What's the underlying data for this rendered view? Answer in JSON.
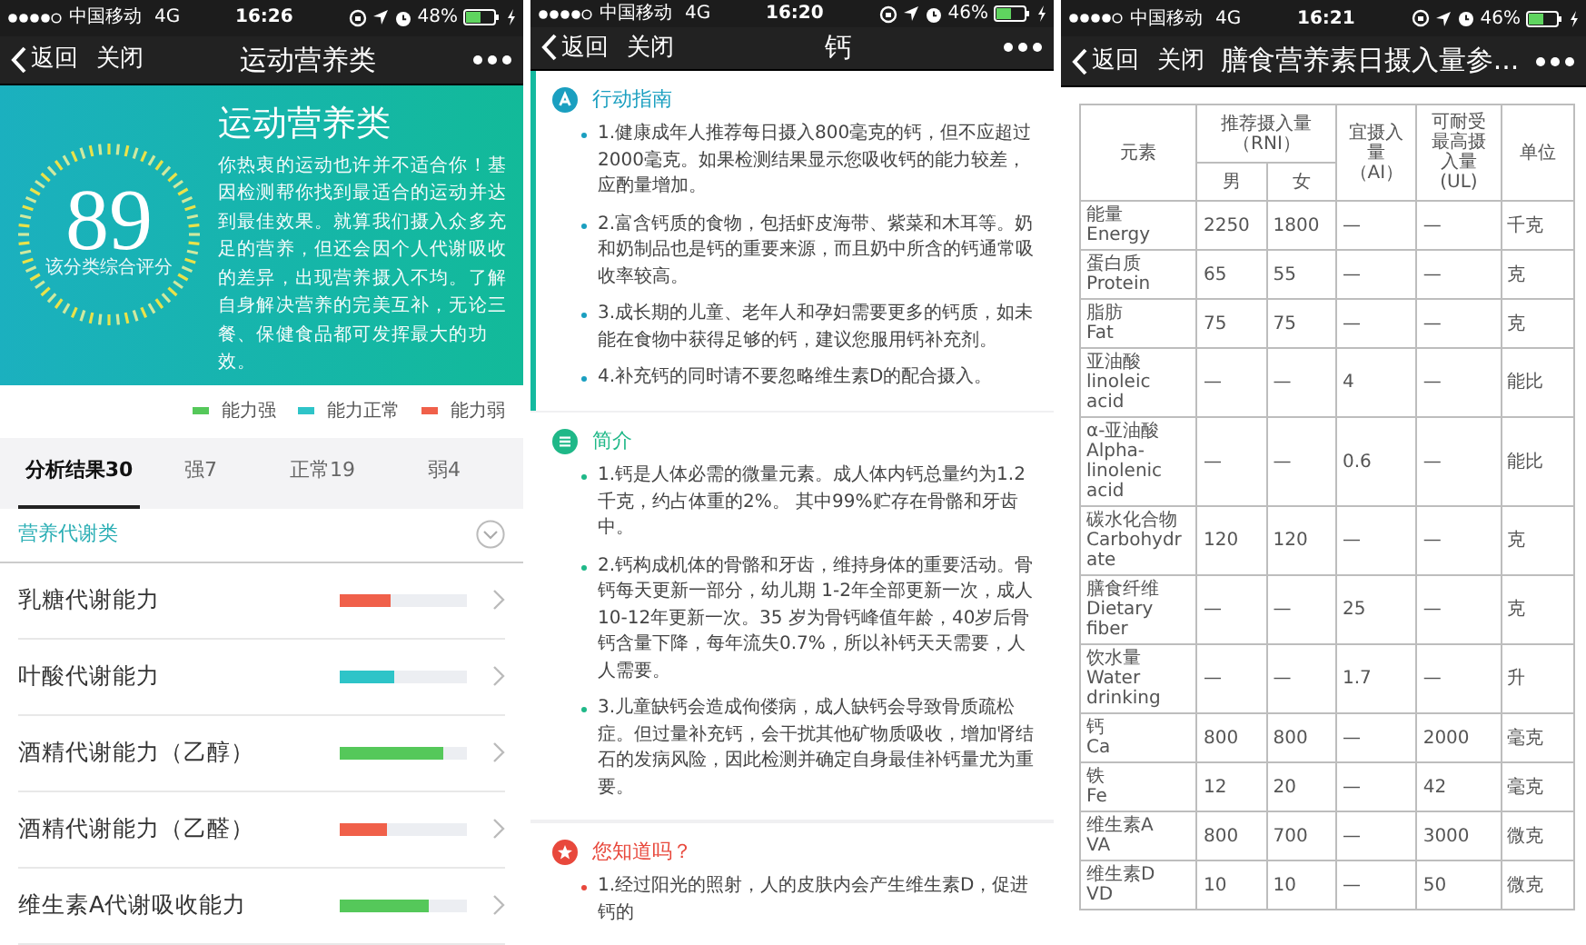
{
  "screens": [
    {
      "status_bar": {
        "carrier": "中国移动",
        "network": "4G",
        "time": "16:26",
        "battery": "48%"
      },
      "nav": {
        "back": "返回",
        "close": "关闭",
        "title": "运动营养类"
      },
      "hero": {
        "score": "89",
        "score_caption": "该分类综合评分",
        "title": "运动营养类",
        "text": "你热衷的运动也许并不适合你！基因检测帮你找到最适合的运动并达到最佳效果。就算我们摄入众多充足的营养，但还会因个人代谢吸收的差异，出现营养摄入不均。了解自身解决营养的完美互补，无论三餐、保健食品都可发挥最大的功效。"
      },
      "legend": [
        {
          "label": "能力强",
          "color": "#55c85a"
        },
        {
          "label": "能力正常",
          "color": "#2ec4c8"
        },
        {
          "label": "能力弱",
          "color": "#f0604a"
        }
      ],
      "tabs": [
        {
          "label": "分析结果30",
          "selected": true
        },
        {
          "label": "强7",
          "selected": false
        },
        {
          "label": "正常19",
          "selected": false
        },
        {
          "label": "弱4",
          "selected": false
        }
      ],
      "category": {
        "title": "营养代谢类",
        "expanded": false
      },
      "items": [
        {
          "label": "乳糖代谢能力",
          "level": 0.4,
          "color": "#f0604a"
        },
        {
          "label": "叶酸代谢能力",
          "level": 0.43,
          "color": "#2ec4c8"
        },
        {
          "label": "酒精代谢能力（乙醇）",
          "level": 0.82,
          "color": "#55c85a"
        },
        {
          "label": "酒精代谢能力（乙醛）",
          "level": 0.37,
          "color": "#f0604a"
        },
        {
          "label": "维生素A代谢吸收能力",
          "level": 0.7,
          "color": "#55c85a"
        }
      ]
    },
    {
      "status_bar": {
        "carrier": "中国移动",
        "network": "4G",
        "time": "16:20",
        "battery": "46%"
      },
      "nav": {
        "back": "返回",
        "close": "关闭",
        "title": "钙"
      },
      "sections": [
        {
          "title": "行动指南",
          "kind": "guide",
          "color": "#1a9fc0",
          "points": [
            "1.健康成年人推荐每日摄入800毫克的钙，但不应超过2000毫克。如果检测结果显示您吸收钙的能力较差，应酌量增加。",
            "2.富含钙质的食物，包括虾皮海带、紫菜和木耳等。奶和奶制品也是钙的重要来源，而且奶中所含的钙通常吸收率较高。",
            "3.成长期的儿童、老年人和孕妇需要更多的钙质，如未能在食物中获得足够的钙，建议您服用钙补充剂。",
            "4.补充钙的同时请不要忽略维生素D的配合摄入。"
          ]
        },
        {
          "title": "简介",
          "kind": "intro",
          "color": "#1fb888",
          "points": [
            "1.钙是人体必需的微量元素。成人体内钙总量约为1.2千克，约占体重的2%。 其中99%贮存在骨骼和牙齿中。",
            "2.钙构成机体的骨骼和牙齿，维持身体的重要活动。骨钙每天更新一部分，幼儿期 1-2年全部更新一次，成人10-12年更新一次。35 岁为骨钙峰值年龄，40岁后骨钙含量下降，每年流失0.7%，所以补钙天天需要，人人需要。",
            "3.儿童缺钙会造成佝偻病，成人缺钙会导致骨质疏松症。但过量补充钙，会干扰其他矿物质吸收，增加肾结石的发病风险，因此检测并确定自身最佳补钙量尤为重要。"
          ]
        },
        {
          "title": "您知道吗？",
          "kind": "tip",
          "color": "#e8483c",
          "points": [
            "1.经过阳光的照射，人的皮肤内会产生维生素D，促进钙的"
          ]
        }
      ]
    },
    {
      "status_bar": {
        "carrier": "中国移动",
        "network": "4G",
        "time": "16:21",
        "battery": "46%"
      },
      "nav": {
        "back": "返回",
        "close": "关闭",
        "title": "膳食营养素日摄入量参..."
      },
      "table": {
        "header": {
          "element": "元素",
          "rni": "推荐摄入量（RNI）",
          "male": "男",
          "female": "女",
          "ai": "宜摄入量（AI）",
          "ul": "可耐受最高摄入量(UL)",
          "unit": "单位"
        },
        "rows": [
          {
            "cn": "能量",
            "en": "Energy",
            "male": "2250",
            "female": "1800",
            "ai": "—",
            "ul": "—",
            "unit": "千克"
          },
          {
            "cn": "蛋白质",
            "en": "Protein",
            "male": "65",
            "female": "55",
            "ai": "—",
            "ul": "—",
            "unit": "克"
          },
          {
            "cn": "脂肪",
            "en": "Fat",
            "male": "75",
            "female": "75",
            "ai": "—",
            "ul": "—",
            "unit": "克"
          },
          {
            "cn": "亚油酸",
            "en": "linoleic acid",
            "male": "—",
            "female": "—",
            "ai": "4",
            "ul": "—",
            "unit": "能比"
          },
          {
            "cn": "α-亚油酸",
            "en": "Alpha-linolenic acid",
            "male": "—",
            "female": "—",
            "ai": "0.6",
            "ul": "—",
            "unit": "能比"
          },
          {
            "cn": "碳水化合物",
            "en": "Carbohydrate",
            "male": "120",
            "female": "120",
            "ai": "—",
            "ul": "—",
            "unit": "克"
          },
          {
            "cn": "膳食纤维",
            "en": "Dietary fiber",
            "male": "—",
            "female": "—",
            "ai": "25",
            "ul": "—",
            "unit": "克"
          },
          {
            "cn": "饮水量",
            "en": "Water drinking",
            "male": "—",
            "female": "—",
            "ai": "1.7",
            "ul": "—",
            "unit": "升"
          },
          {
            "cn": "钙",
            "en": "Ca",
            "male": "800",
            "female": "800",
            "ai": "—",
            "ul": "2000",
            "unit": "毫克"
          },
          {
            "cn": "铁",
            "en": "Fe",
            "male": "12",
            "female": "20",
            "ai": "—",
            "ul": "42",
            "unit": "毫克"
          },
          {
            "cn": "维生素A",
            "en": "VA",
            "male": "800",
            "female": "700",
            "ai": "—",
            "ul": "3000",
            "unit": "微克"
          },
          {
            "cn": "维生素D",
            "en": "VD",
            "male": "10",
            "female": "10",
            "ai": "—",
            "ul": "50",
            "unit": "微克"
          }
        ]
      }
    }
  ]
}
